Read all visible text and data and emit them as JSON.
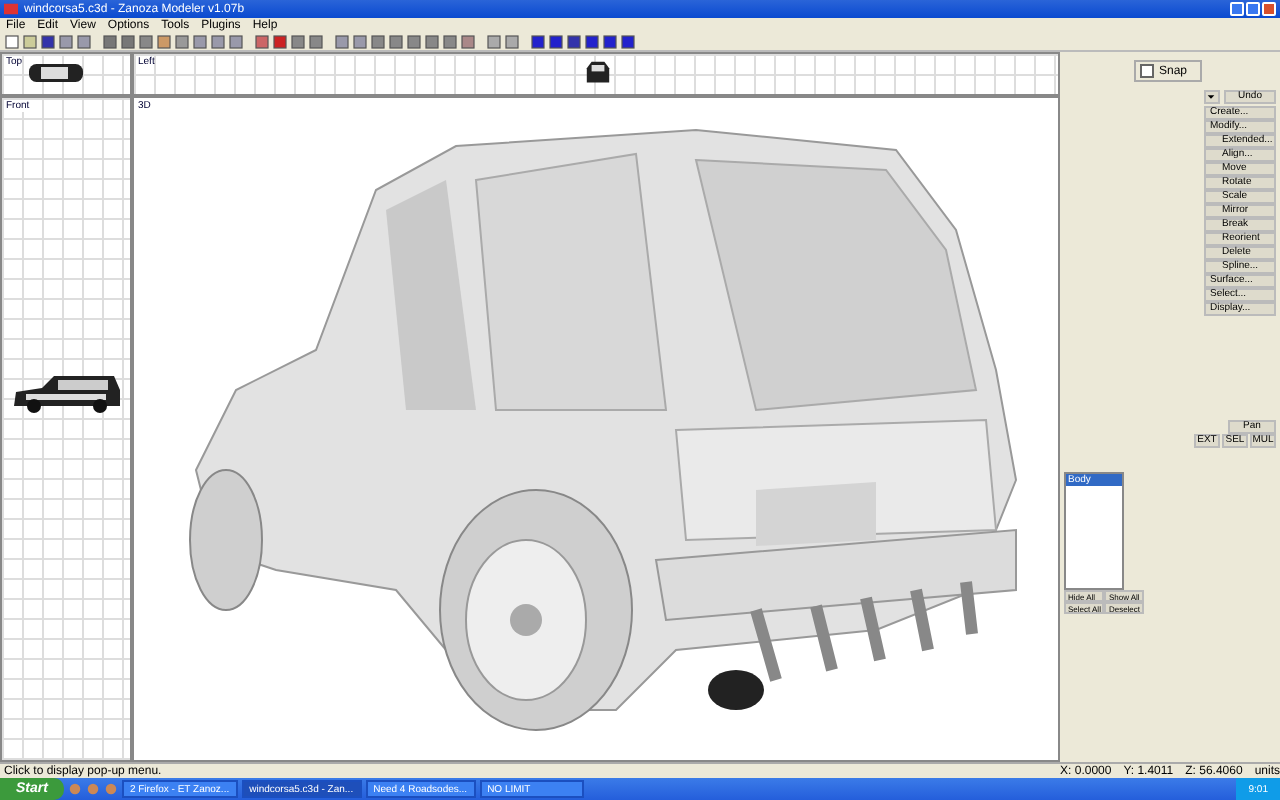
{
  "window": {
    "title": "windcorsa5.c3d - Zanoza Modeler v1.07b"
  },
  "menu": [
    "File",
    "Edit",
    "View",
    "Options",
    "Tools",
    "Plugins",
    "Help"
  ],
  "viewports": {
    "top": {
      "label": "Top"
    },
    "left": {
      "label": "Left"
    },
    "front": {
      "label": "Front"
    },
    "perspective": {
      "label": "3D"
    }
  },
  "panel": {
    "snap": {
      "label": "Snap",
      "checked": false
    },
    "undo": "Undo",
    "commands": [
      {
        "label": "Create..."
      },
      {
        "label": "Modify...",
        "children": [
          {
            "label": "Extended..."
          },
          {
            "label": "Align..."
          },
          {
            "label": "Move"
          },
          {
            "label": "Rotate"
          },
          {
            "label": "Scale"
          },
          {
            "label": "Mirror"
          },
          {
            "label": "Break"
          },
          {
            "label": "Reorient"
          },
          {
            "label": "Delete"
          },
          {
            "label": "Spline..."
          }
        ]
      },
      {
        "label": "Surface..."
      },
      {
        "label": "Select..."
      },
      {
        "label": "Display..."
      }
    ],
    "pan": "Pan",
    "modes": [
      "EXT",
      "SEL",
      "MUL"
    ],
    "objects": [
      {
        "label": "Body",
        "selected": true
      }
    ],
    "list_buttons": [
      "Hide All",
      "Show All",
      "Select All",
      "Deselect"
    ]
  },
  "status_bar": {
    "message": "Click to display pop-up menu.",
    "x": "X: 0.0000",
    "y": "Y: 1.4011",
    "z": "Z: 56.4060",
    "units": "units"
  },
  "taskbar": {
    "start": "Start",
    "tasks": [
      {
        "label": "2 Firefox - ET Zanoz...",
        "selected": false
      },
      {
        "label": "windcorsa5.c3d - Zan...",
        "selected": true
      },
      {
        "label": "Need 4 Roadsodes...",
        "selected": false
      },
      {
        "label": "NO LIMIT",
        "selected": false
      }
    ],
    "clock": "9:01"
  }
}
